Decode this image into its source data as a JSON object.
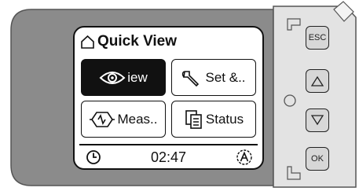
{
  "screen": {
    "title": "Quick View",
    "tiles": [
      {
        "label": "iew",
        "icon": "eye-icon",
        "active": true
      },
      {
        "label": "Set &..",
        "icon": "wrench-icon",
        "active": false
      },
      {
        "label": "Meas..",
        "icon": "measure-icon",
        "active": false
      },
      {
        "label": "Status",
        "icon": "documents-icon",
        "active": false
      }
    ],
    "status": {
      "time": "02:47",
      "clock_icon": "clock-icon",
      "mode_icon": "auto-mode-icon"
    }
  },
  "buttons": {
    "esc": "ESC",
    "up": "up-arrow-icon",
    "down": "down-arrow-icon",
    "ok": "OK"
  },
  "colors": {
    "housing": "#8b8b8b",
    "side_panel": "#e3e3e3",
    "buttons": "#d7d7d7",
    "screen": "#ffffff"
  }
}
